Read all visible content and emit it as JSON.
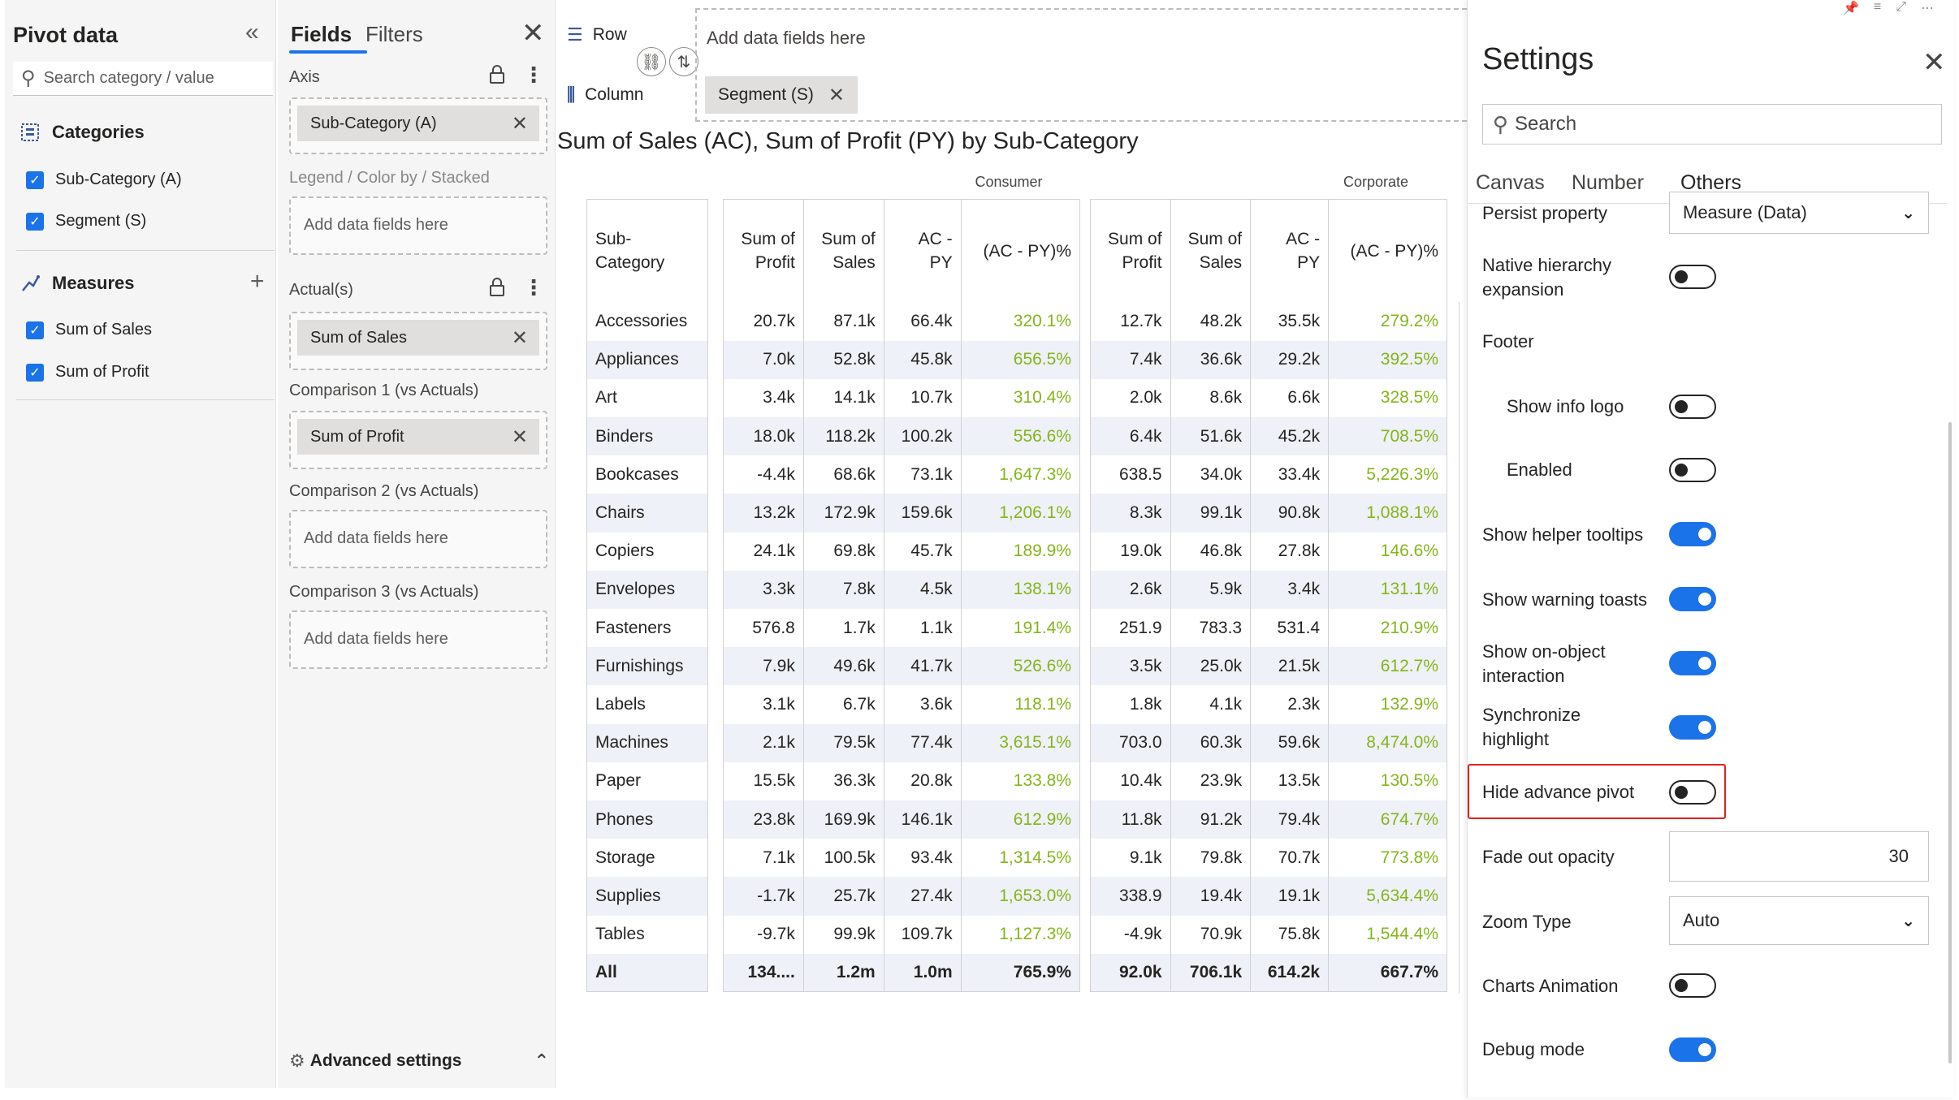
{
  "pivot_panel": {
    "title": "Pivot data",
    "search_placeholder": "Search category / value",
    "categories_title": "Categories",
    "categories": [
      "Sub-Category (A)",
      "Segment (S)"
    ],
    "measures_title": "Measures",
    "measures": [
      "Sum of Sales",
      "Sum of Profit"
    ]
  },
  "fields_panel": {
    "tab_fields": "Fields",
    "tab_filters": "Filters",
    "axis_label": "Axis",
    "axis_value": "Sub-Category (A)",
    "legend_label": "Legend / Color by / Stacked",
    "actuals_label": "Actual(s)",
    "actuals_value": "Sum of Sales",
    "comp1_label": "Comparison 1 (vs Actuals)",
    "comp1_value": "Sum of Profit",
    "comp2_label": "Comparison 2 (vs Actuals)",
    "comp3_label": "Comparison 3 (vs Actuals)",
    "drop_placeholder": "Add data fields here",
    "advanced_settings": "Advanced settings"
  },
  "visual": {
    "row_label": "Row",
    "column_label": "Column",
    "row_placeholder": "Add data fields here",
    "column_pill": "Segment (S)",
    "title": "Sum of Sales (AC), Sum of Profit (PY) by Sub-Category",
    "groups": [
      "Consumer",
      "Corporate"
    ],
    "category_header": "Sub-Category",
    "measure_headers": [
      {
        "a": "Sum of",
        "b": "Profit"
      },
      {
        "a": "Sum of",
        "b": "Sales"
      },
      {
        "a": "AC -",
        "b": "PY"
      },
      {
        "a": "(AC - PY)%",
        "b": ""
      }
    ],
    "rows": [
      {
        "name": "Accessories",
        "consumer": [
          "20.7k",
          "87.1k",
          "66.4k",
          "320.1%"
        ],
        "corporate": [
          "12.7k",
          "48.2k",
          "35.5k",
          "279.2%"
        ]
      },
      {
        "name": "Appliances",
        "consumer": [
          "7.0k",
          "52.8k",
          "45.8k",
          "656.5%"
        ],
        "corporate": [
          "7.4k",
          "36.6k",
          "29.2k",
          "392.5%"
        ]
      },
      {
        "name": "Art",
        "consumer": [
          "3.4k",
          "14.1k",
          "10.7k",
          "310.4%"
        ],
        "corporate": [
          "2.0k",
          "8.6k",
          "6.6k",
          "328.5%"
        ]
      },
      {
        "name": "Binders",
        "consumer": [
          "18.0k",
          "118.2k",
          "100.2k",
          "556.6%"
        ],
        "corporate": [
          "6.4k",
          "51.6k",
          "45.2k",
          "708.5%"
        ]
      },
      {
        "name": "Bookcases",
        "consumer": [
          "-4.4k",
          "68.6k",
          "73.1k",
          "1,647.3%"
        ],
        "corporate": [
          "638.5",
          "34.0k",
          "33.4k",
          "5,226.3%"
        ]
      },
      {
        "name": "Chairs",
        "consumer": [
          "13.2k",
          "172.9k",
          "159.6k",
          "1,206.1%"
        ],
        "corporate": [
          "8.3k",
          "99.1k",
          "90.8k",
          "1,088.1%"
        ]
      },
      {
        "name": "Copiers",
        "consumer": [
          "24.1k",
          "69.8k",
          "45.7k",
          "189.9%"
        ],
        "corporate": [
          "19.0k",
          "46.8k",
          "27.8k",
          "146.6%"
        ]
      },
      {
        "name": "Envelopes",
        "consumer": [
          "3.3k",
          "7.8k",
          "4.5k",
          "138.1%"
        ],
        "corporate": [
          "2.6k",
          "5.9k",
          "3.4k",
          "131.1%"
        ]
      },
      {
        "name": "Fasteners",
        "consumer": [
          "576.8",
          "1.7k",
          "1.1k",
          "191.4%"
        ],
        "corporate": [
          "251.9",
          "783.3",
          "531.4",
          "210.9%"
        ]
      },
      {
        "name": "Furnishings",
        "consumer": [
          "7.9k",
          "49.6k",
          "41.7k",
          "526.6%"
        ],
        "corporate": [
          "3.5k",
          "25.0k",
          "21.5k",
          "612.7%"
        ]
      },
      {
        "name": "Labels",
        "consumer": [
          "3.1k",
          "6.7k",
          "3.6k",
          "118.1%"
        ],
        "corporate": [
          "1.8k",
          "4.1k",
          "2.3k",
          "132.9%"
        ]
      },
      {
        "name": "Machines",
        "consumer": [
          "2.1k",
          "79.5k",
          "77.4k",
          "3,615.1%"
        ],
        "corporate": [
          "703.0",
          "60.3k",
          "59.6k",
          "8,474.0%"
        ]
      },
      {
        "name": "Paper",
        "consumer": [
          "15.5k",
          "36.3k",
          "20.8k",
          "133.8%"
        ],
        "corporate": [
          "10.4k",
          "23.9k",
          "13.5k",
          "130.5%"
        ]
      },
      {
        "name": "Phones",
        "consumer": [
          "23.8k",
          "169.9k",
          "146.1k",
          "612.9%"
        ],
        "corporate": [
          "11.8k",
          "91.2k",
          "79.4k",
          "674.7%"
        ]
      },
      {
        "name": "Storage",
        "consumer": [
          "7.1k",
          "100.5k",
          "93.4k",
          "1,314.5%"
        ],
        "corporate": [
          "9.1k",
          "79.8k",
          "70.7k",
          "773.8%"
        ]
      },
      {
        "name": "Supplies",
        "consumer": [
          "-1.7k",
          "25.7k",
          "27.4k",
          "1,653.0%"
        ],
        "corporate": [
          "338.9",
          "19.4k",
          "19.1k",
          "5,634.4%"
        ]
      },
      {
        "name": "Tables",
        "consumer": [
          "-9.7k",
          "99.9k",
          "109.7k",
          "1,127.3%"
        ],
        "corporate": [
          "-4.9k",
          "70.9k",
          "75.8k",
          "1,544.4%"
        ]
      },
      {
        "name": "All",
        "consumer": [
          "134....",
          "1.2m",
          "1.0m",
          "765.9%"
        ],
        "corporate": [
          "92.0k",
          "706.1k",
          "614.2k",
          "667.7%"
        ]
      }
    ],
    "positive_color": "#85b51a"
  },
  "settings": {
    "title": "Settings",
    "search_placeholder": "Search",
    "tabs": [
      "Canvas",
      "Number",
      "Others"
    ],
    "active_tab": "Others",
    "persist_label": "Persist property",
    "persist_value": "Measure (Data)",
    "native_label_1": "Native hierarchy",
    "native_label_2": "expansion",
    "footer_label": "Footer",
    "show_info_logo": "Show info logo",
    "enabled": "Enabled",
    "helper_tooltips": "Show helper tooltips",
    "warning_toasts": "Show warning toasts",
    "on_object_1": "Show on-object",
    "on_object_2": "interaction",
    "sync_1": "Synchronize",
    "sync_2": "highlight",
    "hide_pivot": "Hide advance pivot",
    "fade_label": "Fade out opacity",
    "fade_value": "30",
    "zoom_label": "Zoom Type",
    "zoom_value": "Auto",
    "charts_animation": "Charts Animation",
    "debug_mode": "Debug mode",
    "toggle_states": {
      "native_hierarchy": false,
      "show_info_logo": false,
      "enabled": false,
      "helper_tooltips": true,
      "warning_toasts": true,
      "on_object": true,
      "sync_highlight": true,
      "hide_advance_pivot": false,
      "charts_animation": false,
      "debug_mode": true
    },
    "accent_color": "#1a73e8",
    "highlight_color": "#e0201e"
  }
}
